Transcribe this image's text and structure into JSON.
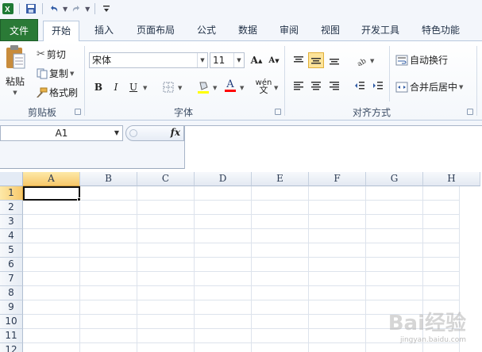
{
  "qat": {
    "save_icon": "save-icon",
    "undo_icon": "undo-icon",
    "redo_icon": "redo-icon",
    "customize_icon": "customize-qat-icon"
  },
  "tabs": [
    {
      "id": "file",
      "label": "文件"
    },
    {
      "id": "home",
      "label": "开始",
      "active": true
    },
    {
      "id": "insert",
      "label": "插入"
    },
    {
      "id": "page-layout",
      "label": "页面布局"
    },
    {
      "id": "formulas",
      "label": "公式"
    },
    {
      "id": "data",
      "label": "数据"
    },
    {
      "id": "review",
      "label": "审阅"
    },
    {
      "id": "view",
      "label": "视图"
    },
    {
      "id": "developer",
      "label": "开发工具"
    },
    {
      "id": "special",
      "label": "特色功能"
    }
  ],
  "clipboard": {
    "label": "剪贴板",
    "paste": "粘贴",
    "cut": "剪切",
    "copy": "复制",
    "format_painter": "格式刷"
  },
  "font": {
    "label": "字体",
    "font_name": "宋体",
    "font_size": "11",
    "bold": "B",
    "italic": "I",
    "underline": "U",
    "font_color": "A",
    "fill_color_hex": "#ffff00",
    "font_color_hex": "#ff0000",
    "phonetic": "wén"
  },
  "alignment": {
    "label": "对齐方式",
    "wrap_text": "自动换行",
    "merge_center": "合并后居中"
  },
  "formula_bar": {
    "name_box": "A1",
    "fx": "fx",
    "value": ""
  },
  "grid": {
    "columns": [
      "A",
      "B",
      "C",
      "D",
      "E",
      "F",
      "G",
      "H"
    ],
    "rows": [
      "1",
      "2",
      "3",
      "4",
      "5",
      "6",
      "7",
      "8",
      "9",
      "10",
      "11",
      "12"
    ],
    "selected_column": "A",
    "selected_row": "1"
  },
  "watermark": {
    "main": "Bai经验",
    "sub": "jingyan.baidu.com"
  },
  "colors": {
    "file_tab": "#2a7a36",
    "selection_header": "#f7c86b",
    "ribbon_bg": "#f3f6fb"
  }
}
